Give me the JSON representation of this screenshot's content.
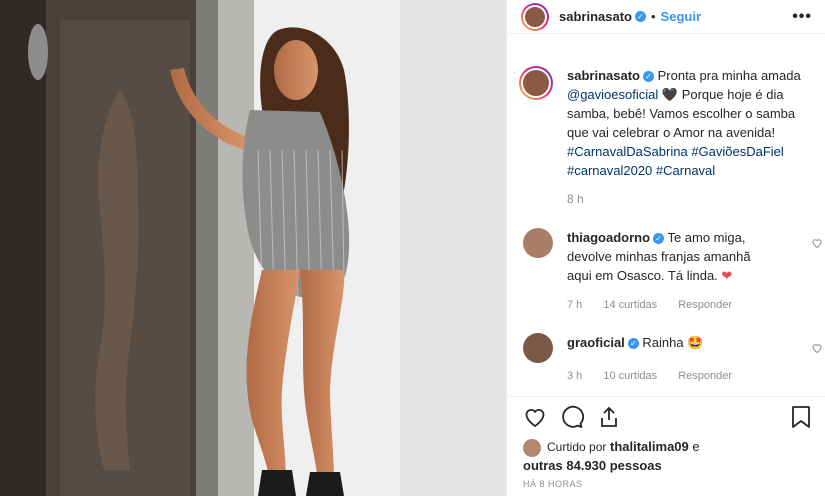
{
  "post": {
    "username": "sabrinasato",
    "follow_label": "Seguir",
    "more_label": "•••",
    "caption": {
      "username": "sabrinasato",
      "text_1": "Pronta pra minha amada",
      "mention": "@gavioesoficial",
      "text_2": "Porque hoje é dia samba, bebê! Vamos escolher o samba que vai celebrar o Amor na avenida!",
      "hashtags": [
        "#CarnavalDaSabrina",
        "#GaviõesDaFiel",
        "#carnaval2020",
        "#Carnaval"
      ],
      "age": "8 h"
    },
    "comments": [
      {
        "username": "thiagoadorno",
        "text": "Te amo miga, devolve minhas franjas amanhã aqui em Osasco. Tá linda.",
        "age": "7 h",
        "likes": "14 curtidas",
        "reply": "Responder"
      },
      {
        "username": "graoficial",
        "text": "Rainha",
        "age": "3 h",
        "likes": "10 curtidas",
        "reply": "Responder"
      }
    ],
    "liked_by_prefix": "Curtido por",
    "liked_by_user": "thalitalima09",
    "liked_by_and": "e",
    "liked_by_others": "outras 84.930 pessoas",
    "timestamp": "HÁ 8 HORAS"
  },
  "colors": {
    "link_blue": "#3897f0",
    "hashtag": "#003569",
    "heart_red": "#ed4956",
    "muted": "#8e8e8e"
  }
}
